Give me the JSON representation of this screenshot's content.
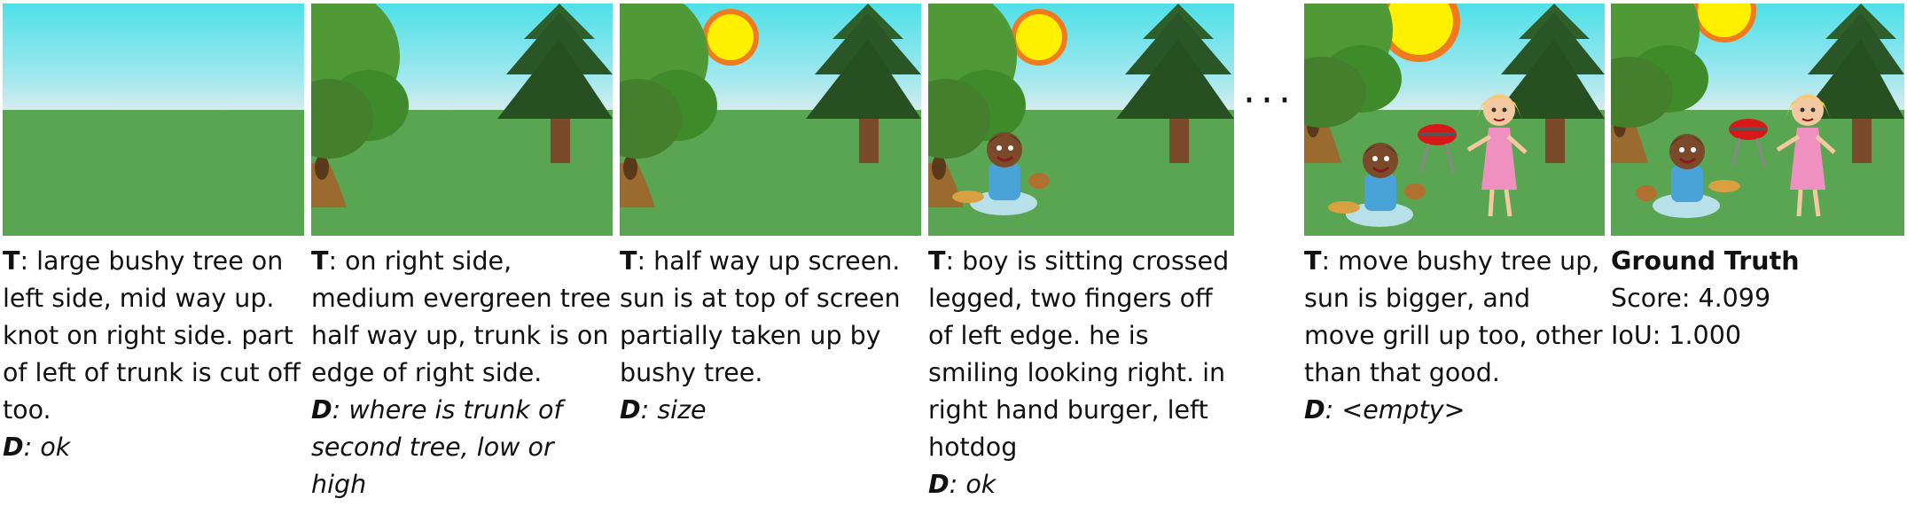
{
  "panels": [
    {
      "t_prefix": "T",
      "t_text": ": large bushy tree on left side, mid way up. knot on right side. part of left of trunk is cut off too.",
      "d_prefix": "D",
      "d_text": ": ok"
    },
    {
      "t_prefix": "T",
      "t_text": ": on right side, medium evergreen tree half way up, trunk is on edge of right side.",
      "d_prefix": "D",
      "d_text": ": where is trunk of second tree, low or high"
    },
    {
      "t_prefix": "T",
      "t_text": ": half way up screen. sun is at top of screen partially taken up by bushy tree.",
      "d_prefix": "D",
      "d_text": ": size"
    },
    {
      "t_prefix": "T",
      "t_text": ": boy is sitting crossed legged, two fingers off of left edge. he is smiling looking right. in right hand burger, left hotdog",
      "d_prefix": "D",
      "d_text": ": ok"
    },
    {
      "t_prefix": "T",
      "t_text": ": move bushy tree up, sun is bigger, and move grill up too, other than that good.",
      "d_prefix": "D",
      "d_text": ": <empty>"
    }
  ],
  "ellipsis": "···",
  "ground_truth": {
    "title": "Ground Truth",
    "score": "Score: 4.099",
    "iou": "IoU: 1.000"
  },
  "colors": {
    "sky_top": "#4ee0e8",
    "sky_bottom": "#d8eef0",
    "grass": "#5aa552",
    "bush": "#4f9a36",
    "pine": "#2e5e2a",
    "trunk": "#7a4a2a",
    "sun": "#fff000",
    "sun_ring": "#f07a20"
  }
}
